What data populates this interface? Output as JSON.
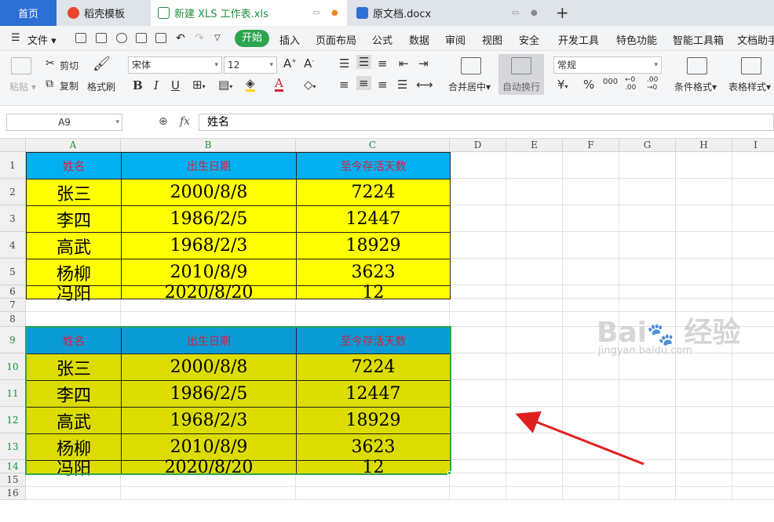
{
  "tabs": [
    {
      "label": "首页"
    },
    {
      "label": "稻壳模板"
    },
    {
      "label": "新建 XLS 工作表.xls"
    },
    {
      "label": "原文档.docx"
    }
  ],
  "menu": {
    "file": "文件",
    "active": "开始",
    "items": [
      "插入",
      "页面布局",
      "公式",
      "数据",
      "审阅",
      "视图",
      "安全",
      "开发工具",
      "特色功能",
      "智能工具箱",
      "文档助手"
    ]
  },
  "ribbon": {
    "paste": "粘贴",
    "cut": "剪切",
    "copy": "复制",
    "format_painter": "格式刷",
    "font_name": "宋体",
    "font_size": "12",
    "merge_center": "合并居中",
    "wrap_text": "自动换行",
    "number_format": "常规",
    "conditional_format": "条件格式",
    "table_style": "表格样式"
  },
  "formula_bar": {
    "name_box": "A9",
    "fx": "fx",
    "content": "姓名"
  },
  "sheet": {
    "columns": [
      "A",
      "B",
      "C",
      "D",
      "E",
      "F",
      "G",
      "H",
      "I"
    ],
    "rows": [
      "1",
      "2",
      "3",
      "4",
      "5",
      "6",
      "7",
      "8",
      "9",
      "10",
      "11",
      "12",
      "13",
      "14",
      "15",
      "16"
    ],
    "headers": [
      "姓名",
      "出生日期",
      "至今存活天数"
    ],
    "table1": [
      [
        "张三",
        "2000/8/8",
        "7224"
      ],
      [
        "李四",
        "1986/2/5",
        "12447"
      ],
      [
        "高武",
        "1968/2/3",
        "18929"
      ],
      [
        "杨柳",
        "2010/8/9",
        "3623"
      ],
      [
        "冯阳",
        "2020/8/20",
        "12"
      ]
    ],
    "table2": [
      [
        "张三",
        "2000/8/8",
        "7224"
      ],
      [
        "李四",
        "1986/2/5",
        "12447"
      ],
      [
        "高武",
        "1968/2/3",
        "18929"
      ],
      [
        "杨柳",
        "2010/8/9",
        "3623"
      ],
      [
        "冯阳",
        "2020/8/20",
        "12"
      ]
    ]
  },
  "colors": {
    "header_fill_1": "#00b0f0",
    "body_fill_1": "#ffff00",
    "header_fill_2": "#0a9bd6",
    "body_fill_2": "#dcdc00",
    "header_text": "#d0223a",
    "selection": "#2ea44f",
    "arrow": "#e02020"
  },
  "watermark": {
    "brand": "Bai 经验",
    "url": "jingyan.baidu.com"
  }
}
